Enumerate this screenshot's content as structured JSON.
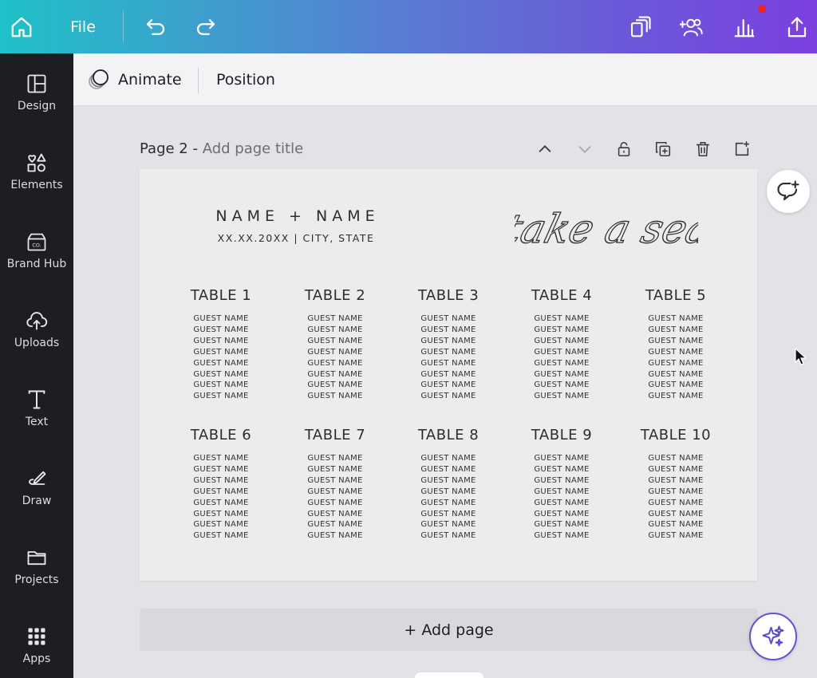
{
  "topbar": {
    "file_label": "File",
    "icons": [
      "home-icon",
      "undo-icon",
      "redo-icon",
      "resize-icon",
      "share-people-icon",
      "insights-icon",
      "upload-share-icon"
    ],
    "notification_color": "#e5262b"
  },
  "sidebar": {
    "items": [
      {
        "label": "Design",
        "icon": "layout-icon"
      },
      {
        "label": "Elements",
        "icon": "shapes-icon"
      },
      {
        "label": "Brand Hub",
        "icon": "brand-icon"
      },
      {
        "label": "Uploads",
        "icon": "cloud-upload-icon"
      },
      {
        "label": "Text",
        "icon": "text-icon"
      },
      {
        "label": "Draw",
        "icon": "pen-icon"
      },
      {
        "label": "Projects",
        "icon": "folder-icon"
      },
      {
        "label": "Apps",
        "icon": "grid-icon"
      }
    ]
  },
  "toolbar": {
    "animate_label": "Animate",
    "position_label": "Position"
  },
  "page": {
    "prefix": "Page 2 - ",
    "title_placeholder": "Add page title"
  },
  "design": {
    "couple": "NAME + NAME",
    "date_line": "XX.XX.20XX | CITY, STATE",
    "script_title": "take a seat",
    "guest_label": "GUEST NAME",
    "tables": [
      {
        "title": "TABLE 1"
      },
      {
        "title": "TABLE 2"
      },
      {
        "title": "TABLE 3"
      },
      {
        "title": "TABLE 4"
      },
      {
        "title": "TABLE 5"
      },
      {
        "title": "TABLE 6"
      },
      {
        "title": "TABLE 7"
      },
      {
        "title": "TABLE 8"
      },
      {
        "title": "TABLE 9"
      },
      {
        "title": "TABLE 10"
      }
    ]
  },
  "add_page_label": "+ Add page",
  "colors": {
    "gradient_start": "#1fc1c8",
    "gradient_end": "#7b3fe0",
    "sidebar": "#1d1e21",
    "magic_accent": "#6b4fd6"
  }
}
